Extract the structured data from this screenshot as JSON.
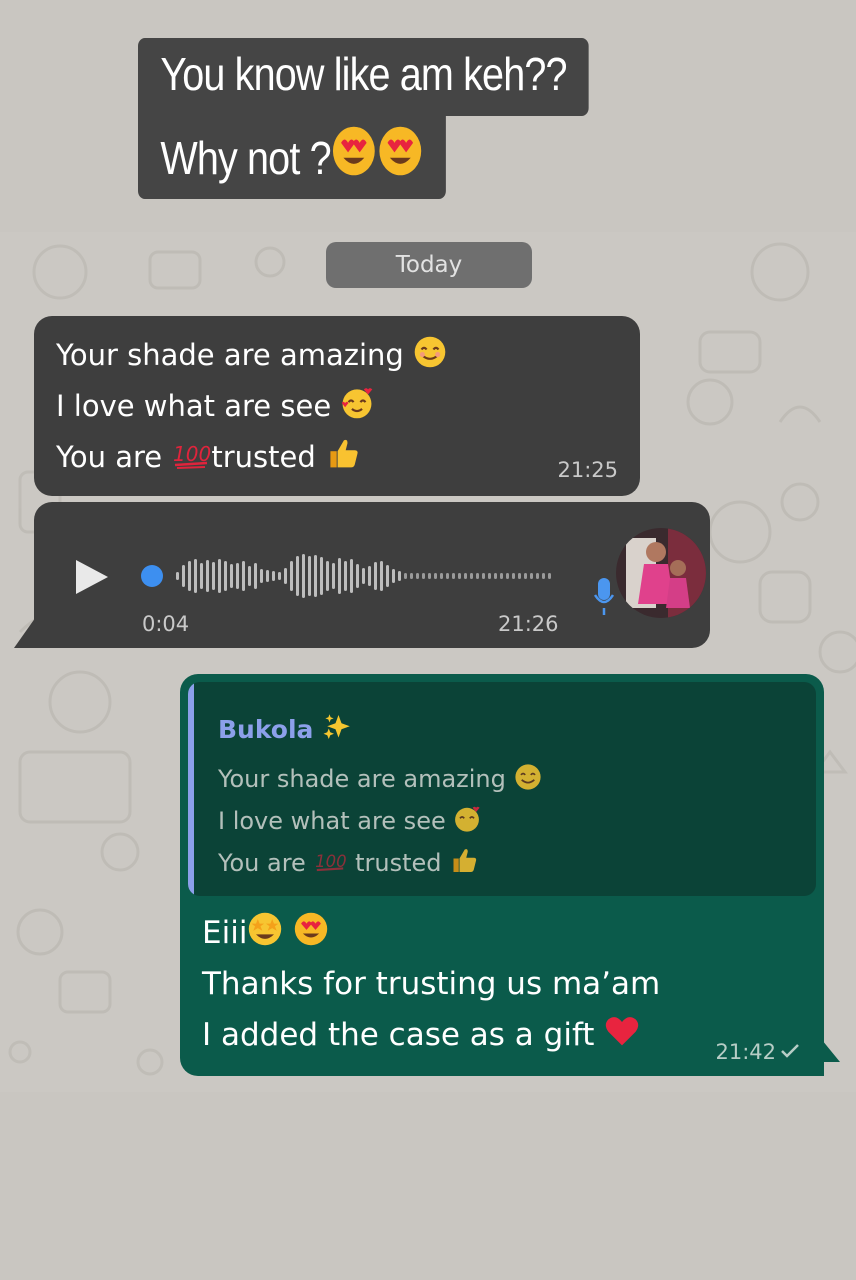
{
  "caption": {
    "line1": "You know like am keh??",
    "line2": "Why not ?"
  },
  "date_separator": "Today",
  "messages": {
    "incoming_text": {
      "lines": [
        "Your shade are amazing",
        "I love what are see",
        "You are",
        "trusted"
      ],
      "time": "21:25"
    },
    "voice_note": {
      "duration": "0:04",
      "time": "21:26",
      "progress": 0.0
    },
    "outgoing_reply": {
      "quoted_sender": "Bukola",
      "quoted_lines": [
        "Your shade are amazing",
        "I love what are see",
        "You are",
        "trusted"
      ],
      "lines": [
        "Eiii",
        "Thanks for trusting us ma’am",
        "I added the case as a gift"
      ],
      "time": "21:42"
    }
  },
  "icons": [
    "heart-eyes-emoji",
    "smiling-emoji",
    "hearts-face-emoji",
    "hundred-points-emoji",
    "thumbs-up-emoji",
    "sparkles-emoji",
    "star-struck-emoji",
    "red-heart-emoji",
    "play-icon",
    "mic-icon",
    "read-check-icon"
  ],
  "colors": {
    "incoming_bubble": "#3e3e3e",
    "outgoing_bubble": "#0b5b4b",
    "quote_accent": "#8ca0ea",
    "voice_progress": "#3d8ff0"
  }
}
